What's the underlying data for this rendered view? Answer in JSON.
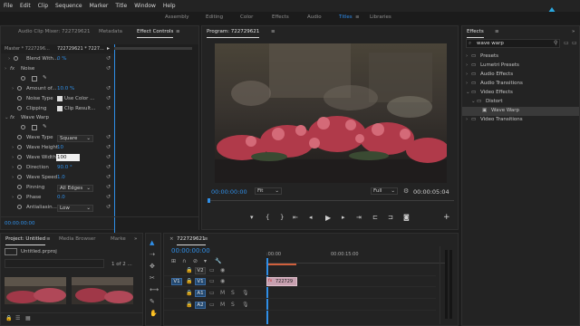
{
  "menu": [
    "File",
    "Edit",
    "Clip",
    "Sequence",
    "Marker",
    "Title",
    "Window",
    "Help"
  ],
  "workspaces": [
    {
      "label": "Assembly",
      "active": false
    },
    {
      "label": "Editing",
      "active": false
    },
    {
      "label": "Color",
      "active": false
    },
    {
      "label": "Effects",
      "active": false
    },
    {
      "label": "Audio",
      "active": false
    },
    {
      "label": "Titles",
      "active": true
    },
    {
      "label": "Libraries",
      "active": false
    }
  ],
  "effect_panel": {
    "tabs": [
      "Audio Clip Mixer: 722729621",
      "Effect Controls",
      "Metadata"
    ],
    "master_label": "Master * 7227296...",
    "clip_label": "722729621 * 7227...",
    "blend_label": "Blend With...",
    "blend_value": "0 %",
    "noise_header": "Noise",
    "amount_label": "Amount of...",
    "amount_value": "10.0 %",
    "noise_type_label": "Noise Type",
    "use_color_label": "Use Color ...",
    "clipping_label": "Clipping",
    "clip_result_label": "Clip Result...",
    "wave_header": "Wave Warp",
    "wave_type_label": "Wave Type",
    "wave_type_value": "Square",
    "wave_height_label": "Wave Height",
    "wave_height_value": "10",
    "wave_width_label": "Wave Width",
    "wave_width_value": "100",
    "direction_label": "Direction",
    "direction_value": "90.0 °",
    "wave_speed_label": "Wave Speed",
    "wave_speed_value": "1.0",
    "pinning_label": "Pinning",
    "pinning_value": "All Edges",
    "phase_label": "Phase",
    "phase_value": "0.0",
    "antialias_label": "Antialiasin...",
    "antialias_value": "Low",
    "timecode": "00:00:00:00"
  },
  "program": {
    "title": "Program: 722729621",
    "timecode_left": "00:00:00:00",
    "fit_label": "Fit",
    "full_label": "Full",
    "timecode_right": "00:00:05:04"
  },
  "effects_panel": {
    "title": "Effects",
    "search_value": "wave warp",
    "tree": [
      {
        "label": "Presets",
        "level": 0,
        "open": false
      },
      {
        "label": "Lumetri Presets",
        "level": 0,
        "open": false
      },
      {
        "label": "Audio Effects",
        "level": 0,
        "open": false
      },
      {
        "label": "Audio Transitions",
        "level": 0,
        "open": false
      },
      {
        "label": "Video Effects",
        "level": 0,
        "open": true
      },
      {
        "label": "Distort",
        "level": 1,
        "open": true
      },
      {
        "label": "Wave Warp",
        "level": 2,
        "selected": true
      },
      {
        "label": "Video Transitions",
        "level": 0,
        "open": false
      }
    ]
  },
  "project_panel": {
    "tabs": [
      "Project: Untitled",
      "Media Browser",
      "Marke"
    ],
    "file_name": "Untitled.prproj",
    "page_label": "1 of 2 ..."
  },
  "timeline": {
    "title": "722729621",
    "timecode": "00:00:00:00",
    "ruler_labels": [
      ":00:00",
      "00:00:15:00"
    ],
    "clip_label": "722729",
    "tracks": [
      {
        "label": "V2",
        "patch": "",
        "type": "video"
      },
      {
        "label": "V1",
        "patch": "V1",
        "type": "video"
      },
      {
        "label": "A1",
        "patch": "A1",
        "type": "audio"
      },
      {
        "label": "A2",
        "patch": "A2",
        "type": "audio"
      }
    ],
    "meter_labels": [
      "S",
      "S"
    ]
  },
  "colors": {
    "accent": "#2d8ceb",
    "clip": "#c8a0b0",
    "selected_bg": "#3a3a3a"
  }
}
